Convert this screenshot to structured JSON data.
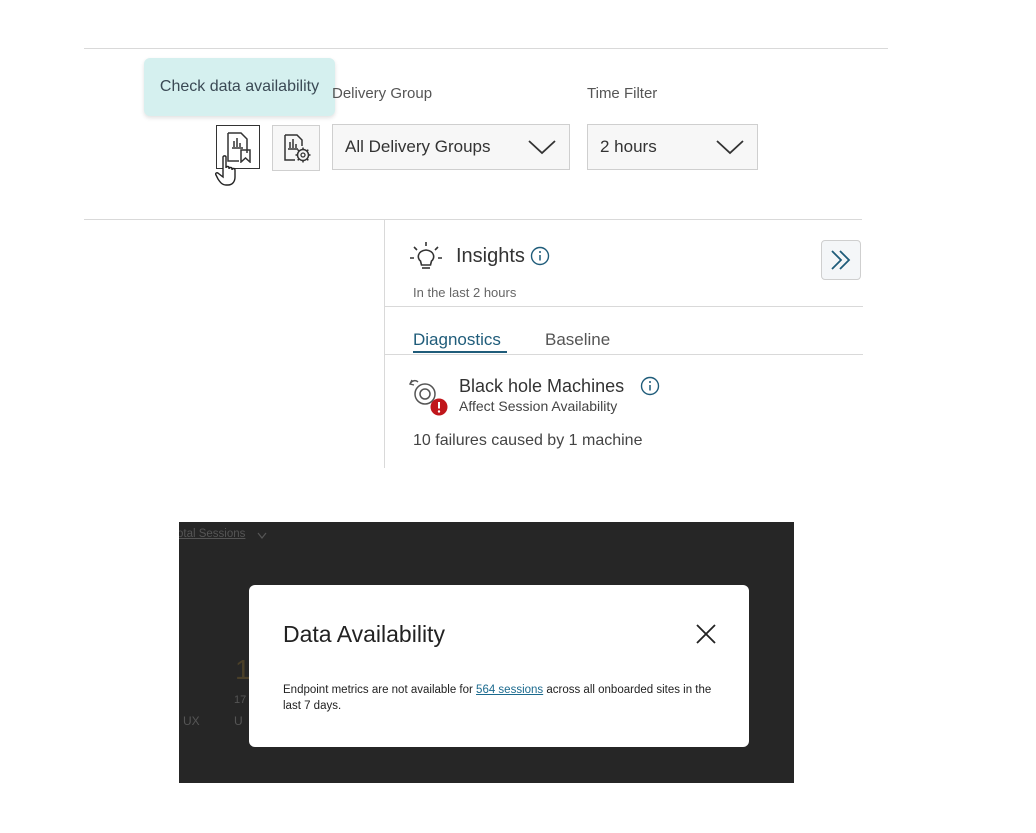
{
  "tooltip": {
    "text": "Check data availability"
  },
  "filters": {
    "delivery_group": {
      "label": "Delivery Group",
      "value": "All Delivery Groups"
    },
    "time_filter": {
      "label": "Time Filter",
      "value": "2 hours"
    }
  },
  "toolbar": {
    "check_data_icon": "report-bookmark-icon",
    "report_settings_icon": "report-gear-icon"
  },
  "insights": {
    "title": "Insights",
    "subtitle": "In the last 2 hours",
    "tabs": [
      {
        "label": "Diagnostics",
        "active": true
      },
      {
        "label": "Baseline",
        "active": false
      }
    ],
    "item": {
      "title": "Black hole Machines",
      "subtitle": "Affect Session Availability",
      "detail": "10 failures caused by 1 machine"
    }
  },
  "background": {
    "link_fragment": "otal Sessions",
    "frag1": "1",
    "frag2": "17",
    "frag3": "UX",
    "frag4": "U"
  },
  "modal": {
    "title": "Data Availability",
    "text_before": "Endpoint metrics are not available for ",
    "link": "564 sessions",
    "text_after": " across all onboarded sites in the last 7 days."
  },
  "colors": {
    "tooltip_bg": "#d5f0ef",
    "accent": "#1f5c7a",
    "error": "#c0161b",
    "overlay": "#262626"
  }
}
